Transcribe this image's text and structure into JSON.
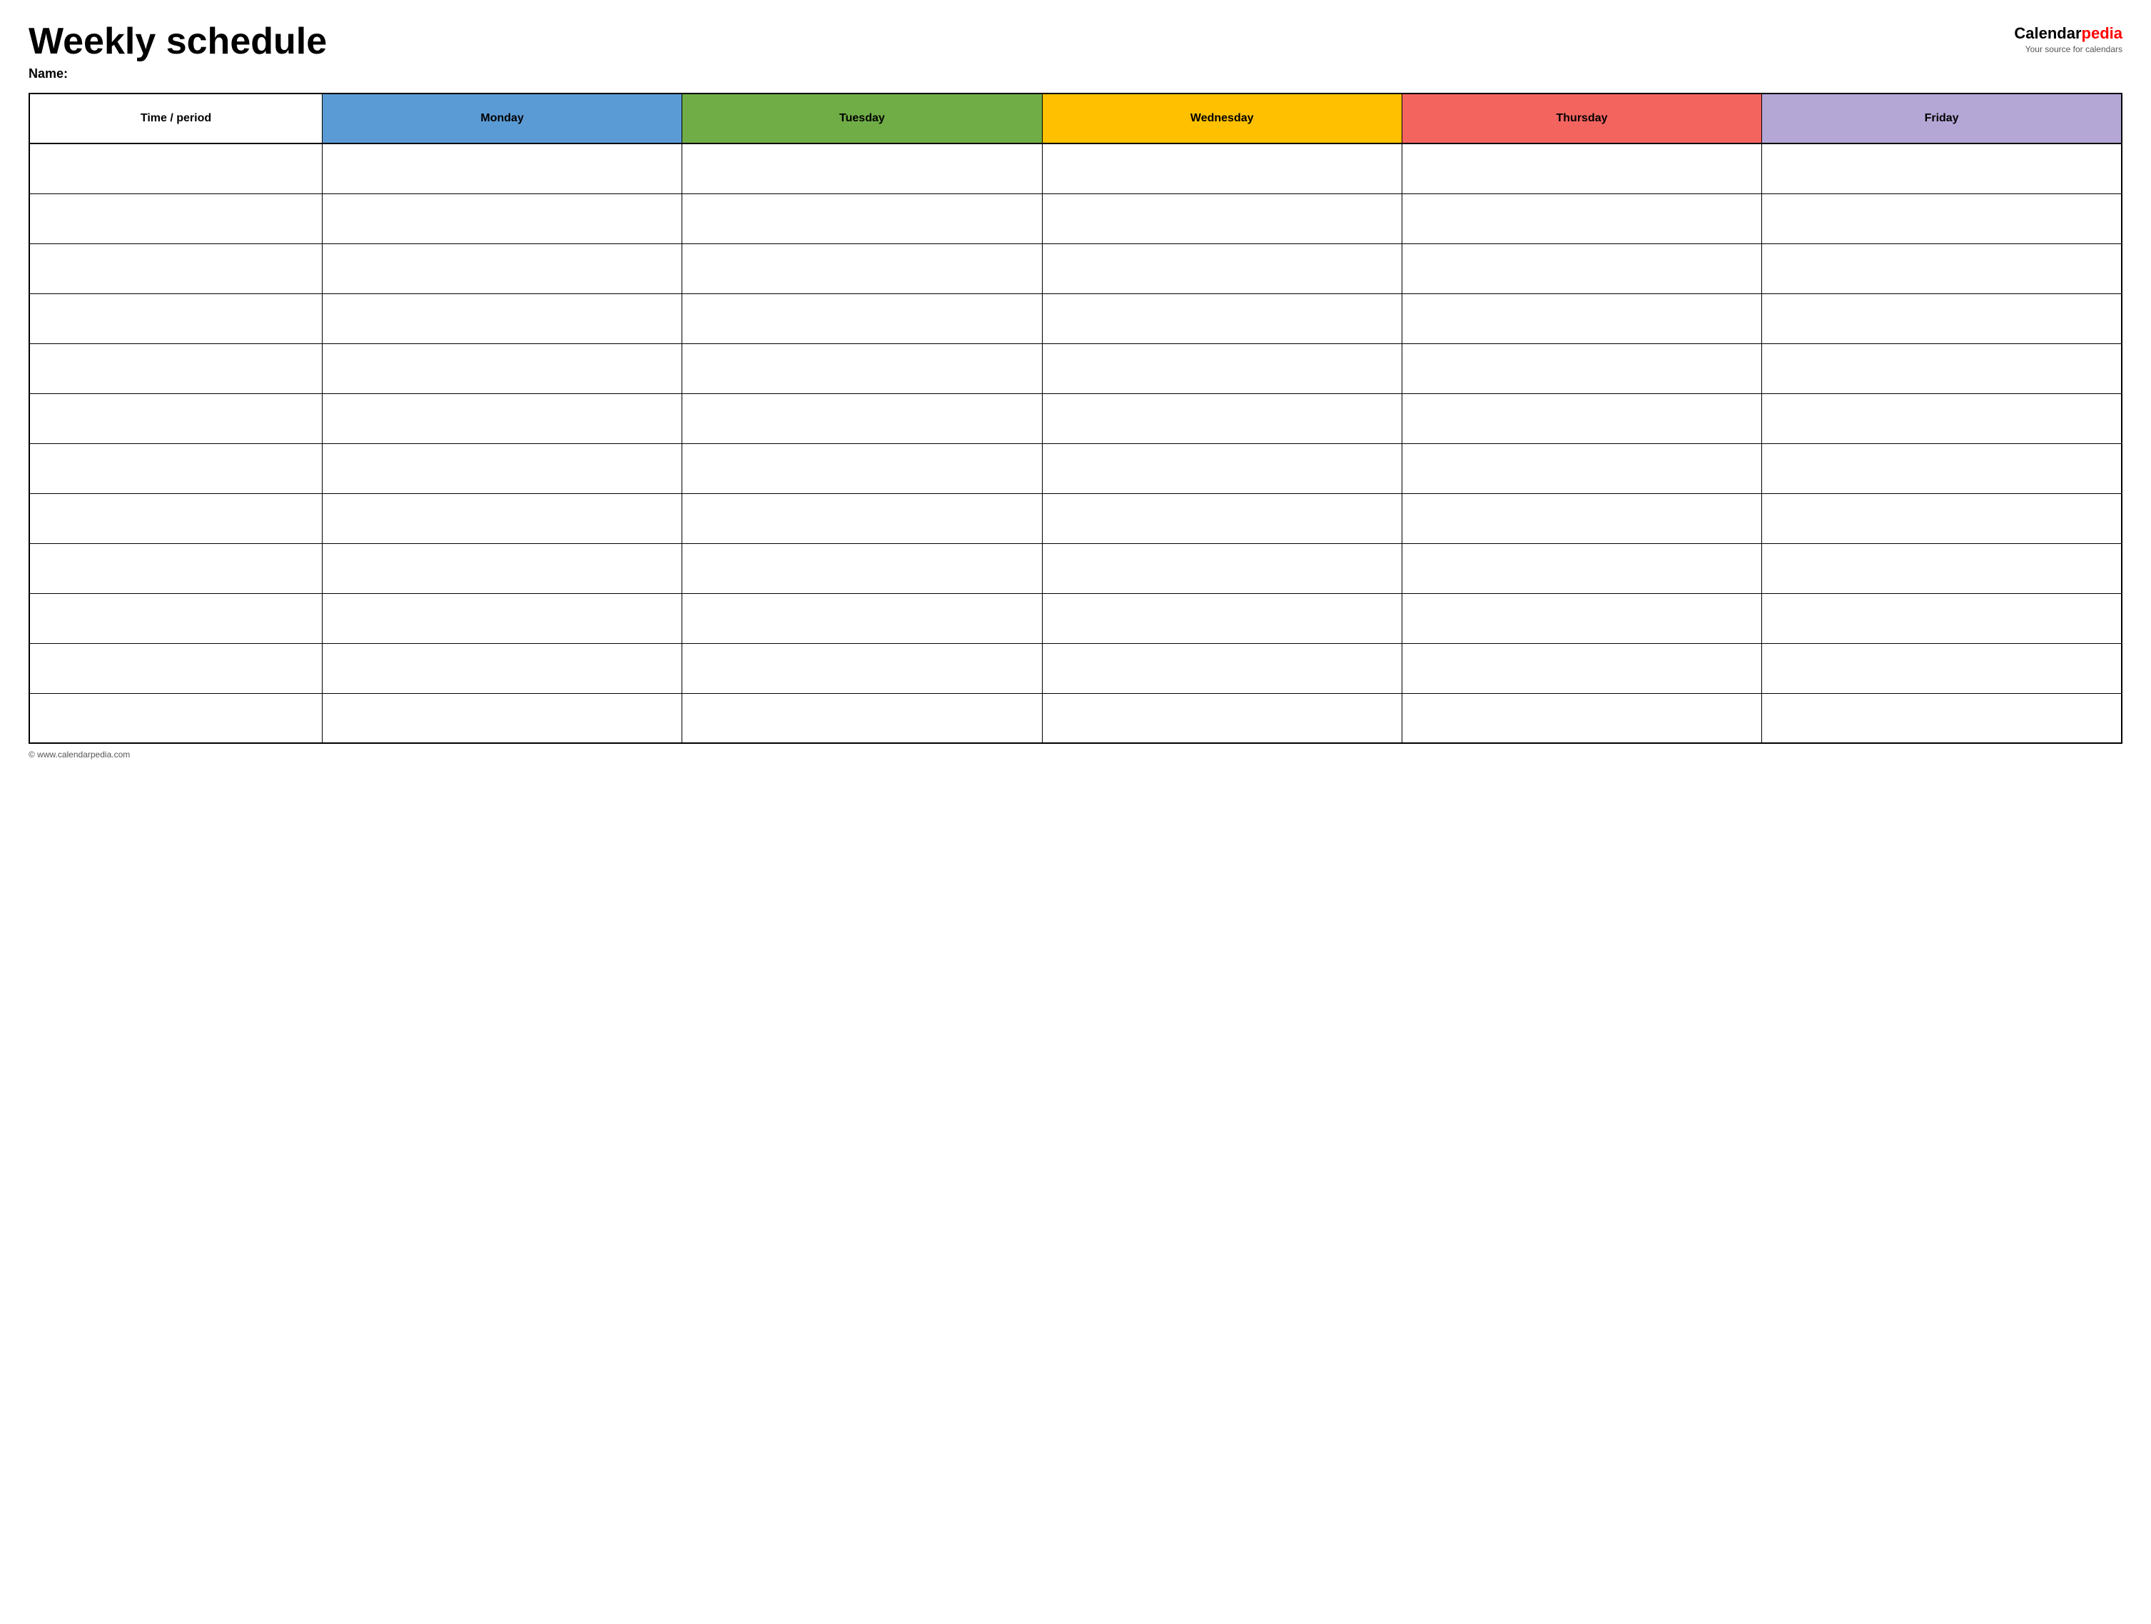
{
  "header": {
    "title": "Weekly schedule",
    "name_label": "Name:",
    "logo_calendar": "Calendar",
    "logo_pedia": "pedia",
    "logo_tagline": "Your source for calendars"
  },
  "table": {
    "columns": [
      {
        "key": "time_period",
        "label": "Time / period",
        "color_class": ""
      },
      {
        "key": "monday",
        "label": "Monday",
        "color_class": "monday"
      },
      {
        "key": "tuesday",
        "label": "Tuesday",
        "color_class": "tuesday"
      },
      {
        "key": "wednesday",
        "label": "Wednesday",
        "color_class": "wednesday"
      },
      {
        "key": "thursday",
        "label": "Thursday",
        "color_class": "thursday"
      },
      {
        "key": "friday",
        "label": "Friday",
        "color_class": "friday"
      }
    ],
    "row_count": 12
  },
  "footer": {
    "copyright": "© www.calendarpedia.com"
  }
}
